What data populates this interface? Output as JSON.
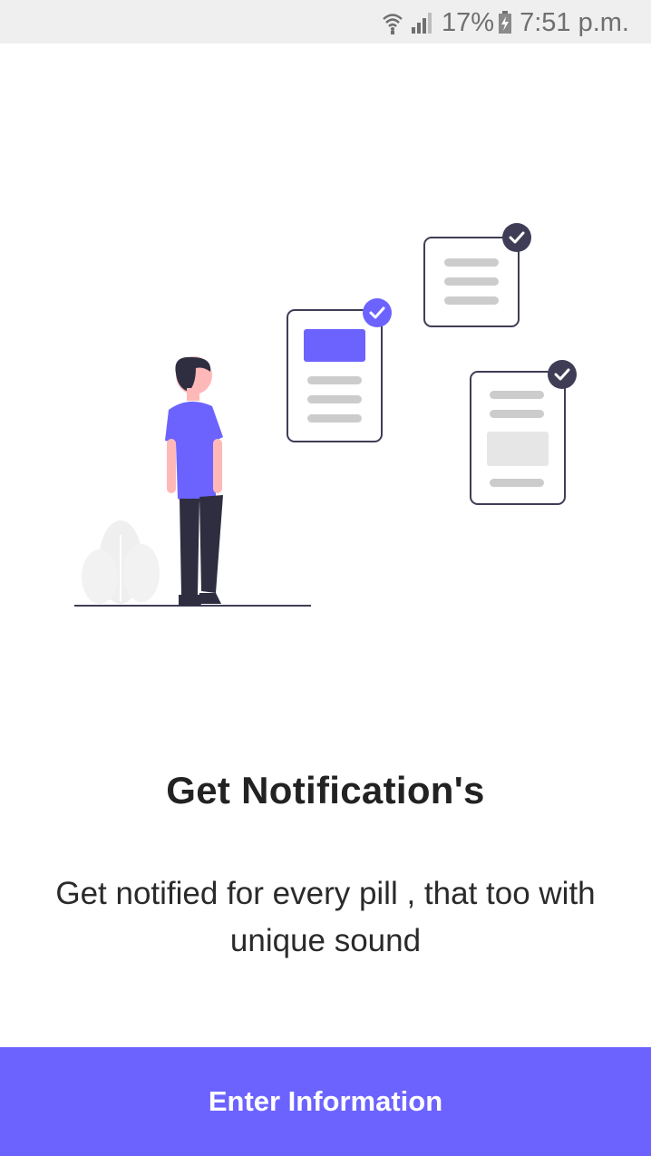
{
  "status_bar": {
    "battery_percent": "17%",
    "time": "7:51 p.m.",
    "icons": [
      "wifi-icon",
      "signal-icon",
      "battery-charging-icon"
    ],
    "color_bg": "#efefef"
  },
  "onboarding": {
    "title": "Get Notification's",
    "description": "Get notified for every pill , that too with unique sound",
    "cta_label": "Enter Information",
    "accent_color": "#6c63ff",
    "dark_color": "#3f3d56"
  }
}
